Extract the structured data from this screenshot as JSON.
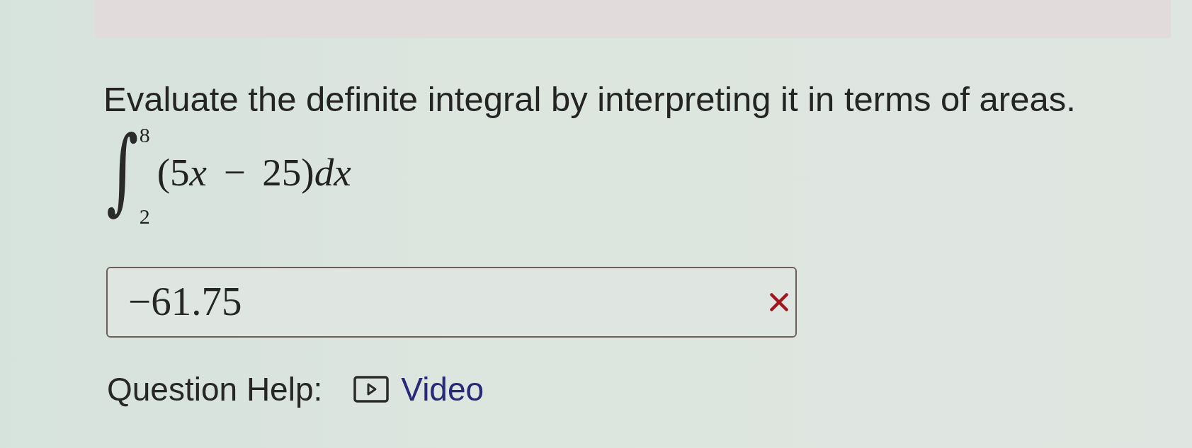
{
  "question": {
    "prompt": "Evaluate the definite integral by interpreting it in terms of areas.",
    "integral": {
      "sign": "∫",
      "upper": "8",
      "lower": "2",
      "integrand": "(5x − 25)dx"
    }
  },
  "answer": {
    "value": "−61.75",
    "correct": false
  },
  "help": {
    "label": "Question Help:",
    "links": [
      {
        "kind": "video",
        "label": "Video"
      }
    ]
  }
}
